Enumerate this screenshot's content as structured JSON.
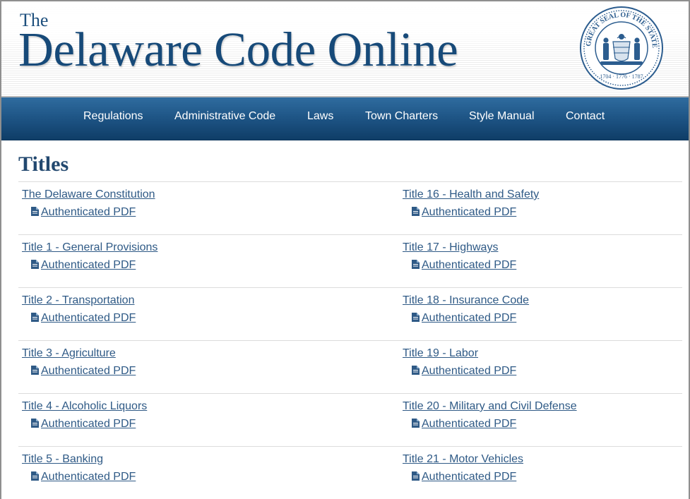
{
  "header": {
    "title_prefix": "The",
    "title_main": "Delaware Code Online",
    "seal": {
      "outer_text": "GREAT SEAL OF THE STATE OF DELAWARE",
      "bottom_text": "1704 · 1776 · 1787",
      "colors": {
        "ring": "#2c5d8f",
        "fill": "#ffffff"
      }
    }
  },
  "nav": {
    "items": [
      {
        "id": "regulations",
        "label": "Regulations"
      },
      {
        "id": "administrative-code",
        "label": "Administrative Code"
      },
      {
        "id": "laws",
        "label": "Laws"
      },
      {
        "id": "town-charters",
        "label": "Town Charters"
      },
      {
        "id": "style-manual",
        "label": "Style Manual"
      },
      {
        "id": "contact",
        "label": "Contact"
      }
    ]
  },
  "main": {
    "heading": "Titles",
    "pdf_icon": "file-icon",
    "pdf_label": "Authenticated PDF",
    "left_titles": [
      "The Delaware Constitution",
      "Title 1 - General Provisions",
      "Title 2 - Transportation",
      "Title 3 - Agriculture",
      "Title 4 - Alcoholic Liquors",
      "Title 5 - Banking"
    ],
    "right_titles": [
      "Title 16 - Health and Safety",
      "Title 17 - Highways",
      "Title 18 - Insurance Code",
      "Title 19 - Labor",
      "Title 20 - Military and Civil Defense",
      "Title 21 - Motor Vehicles"
    ]
  },
  "colors": {
    "brand_blue": "#174a79",
    "nav_top": "#2f6c9f",
    "nav_bottom": "#0f3d67",
    "link": "#2f5a86",
    "heading": "#22486f"
  }
}
